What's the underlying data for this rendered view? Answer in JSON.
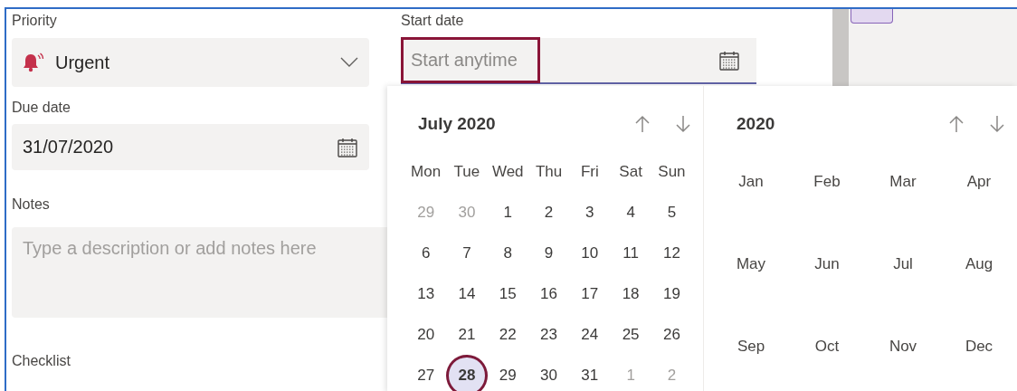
{
  "priority": {
    "label": "Priority",
    "value": "Urgent"
  },
  "start_date": {
    "label": "Start date",
    "placeholder": "Start anytime",
    "highlighted": true
  },
  "due_date": {
    "label": "Due date",
    "value": "31/07/2020"
  },
  "notes": {
    "label": "Notes",
    "placeholder": "Type a description or add notes here"
  },
  "checklist": {
    "label": "Checklist"
  },
  "calendar": {
    "month_title": "July 2020",
    "weekdays": [
      "Mon",
      "Tue",
      "Wed",
      "Thu",
      "Fri",
      "Sat",
      "Sun"
    ],
    "weeks": [
      [
        {
          "day": "29",
          "outside": true,
          "selected": false
        },
        {
          "day": "30",
          "outside": true,
          "selected": false
        },
        {
          "day": "1",
          "outside": false,
          "selected": false
        },
        {
          "day": "2",
          "outside": false,
          "selected": false
        },
        {
          "day": "3",
          "outside": false,
          "selected": false
        },
        {
          "day": "4",
          "outside": false,
          "selected": false
        },
        {
          "day": "5",
          "outside": false,
          "selected": false
        }
      ],
      [
        {
          "day": "6",
          "outside": false,
          "selected": false
        },
        {
          "day": "7",
          "outside": false,
          "selected": false
        },
        {
          "day": "8",
          "outside": false,
          "selected": false
        },
        {
          "day": "9",
          "outside": false,
          "selected": false
        },
        {
          "day": "10",
          "outside": false,
          "selected": false
        },
        {
          "day": "11",
          "outside": false,
          "selected": false
        },
        {
          "day": "12",
          "outside": false,
          "selected": false
        }
      ],
      [
        {
          "day": "13",
          "outside": false,
          "selected": false
        },
        {
          "day": "14",
          "outside": false,
          "selected": false
        },
        {
          "day": "15",
          "outside": false,
          "selected": false
        },
        {
          "day": "16",
          "outside": false,
          "selected": false
        },
        {
          "day": "17",
          "outside": false,
          "selected": false
        },
        {
          "day": "18",
          "outside": false,
          "selected": false
        },
        {
          "day": "19",
          "outside": false,
          "selected": false
        }
      ],
      [
        {
          "day": "20",
          "outside": false,
          "selected": false
        },
        {
          "day": "21",
          "outside": false,
          "selected": false
        },
        {
          "day": "22",
          "outside": false,
          "selected": false
        },
        {
          "day": "23",
          "outside": false,
          "selected": false
        },
        {
          "day": "24",
          "outside": false,
          "selected": false
        },
        {
          "day": "25",
          "outside": false,
          "selected": false
        },
        {
          "day": "26",
          "outside": false,
          "selected": false
        }
      ],
      [
        {
          "day": "27",
          "outside": false,
          "selected": false
        },
        {
          "day": "28",
          "outside": false,
          "selected": true
        },
        {
          "day": "29",
          "outside": false,
          "selected": false
        },
        {
          "day": "30",
          "outside": false,
          "selected": false
        },
        {
          "day": "31",
          "outside": false,
          "selected": false
        },
        {
          "day": "1",
          "outside": true,
          "selected": false
        },
        {
          "day": "2",
          "outside": true,
          "selected": false
        }
      ]
    ],
    "year_title": "2020",
    "months": [
      "Jan",
      "Feb",
      "Mar",
      "Apr",
      "May",
      "Jun",
      "Jul",
      "Aug",
      "Sep",
      "Oct",
      "Nov",
      "Dec"
    ]
  }
}
